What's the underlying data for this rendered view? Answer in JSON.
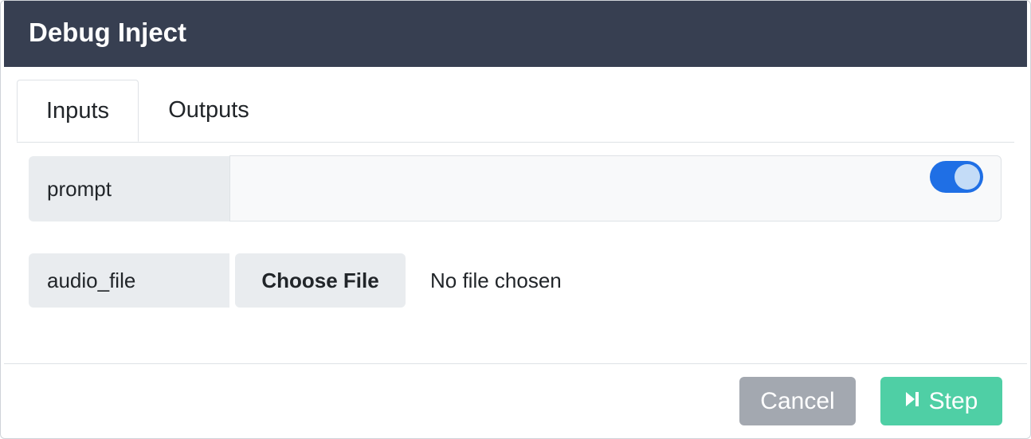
{
  "modal": {
    "title": "Debug Inject"
  },
  "tabs": [
    {
      "label": "Inputs",
      "active": true
    },
    {
      "label": "Outputs",
      "active": false
    }
  ],
  "fields": {
    "prompt": {
      "label": "prompt",
      "value": "",
      "toggle_on": true
    },
    "audio_file": {
      "label": "audio_file",
      "button_label": "Choose File",
      "status": "No file chosen"
    }
  },
  "footer": {
    "cancel_label": "Cancel",
    "step_label": "Step",
    "step_icon": "step-forward-icon"
  },
  "colors": {
    "header_bg": "#373f51",
    "toggle_on": "#1f6fe5",
    "cancel_bg": "#a3a8b0",
    "step_bg": "#4fcfa5"
  }
}
